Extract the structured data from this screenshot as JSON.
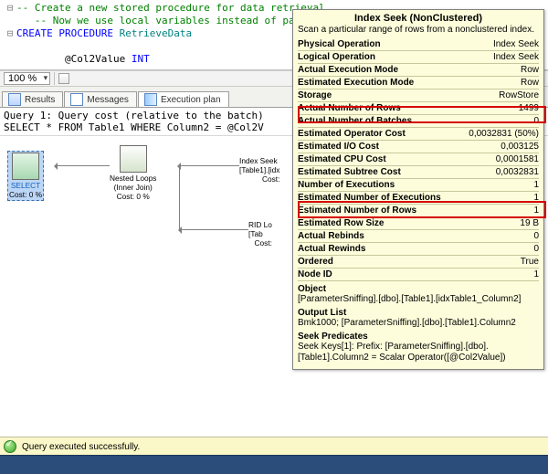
{
  "code": {
    "l1_a": "-- Create a new stored procedure for data retrieval.",
    "l2_a": "   -- Now we use local variables instead of parameter values",
    "l3_kw": "CREATE PROCEDURE ",
    "l3_name": "RetrieveData",
    "l5_a": "        @Col2Value ",
    "l5_kw": "INT"
  },
  "zoom": {
    "value": "100 %"
  },
  "tabs": {
    "results": "Results",
    "messages": "Messages",
    "plan": "Execution plan"
  },
  "qhdr": {
    "l1": "Query 1: Query cost (relative to the batch)",
    "l2": "SELECT * FROM Table1 WHERE Column2 = @Col2V"
  },
  "plan": {
    "select": {
      "l1": "SELECT",
      "l2": "Cost: 0 %"
    },
    "nested": {
      "l1": "Nested Loops",
      "l2": "(Inner Join)",
      "l3": "Cost: 0 %"
    },
    "seek": {
      "l1": "Index Seek",
      "l2": "[Table1].[idx",
      "l3": "Cost:"
    },
    "rid": {
      "l1": "RID Lo",
      "l2": "[Tab",
      "l3": "Cost:"
    }
  },
  "tip": {
    "title": "Index Seek (NonClustered)",
    "desc": "Scan a particular range of rows from a nonclustered index.",
    "rows": [
      {
        "k": "Physical Operation",
        "v": "Index Seek",
        "b": true
      },
      {
        "k": "Logical Operation",
        "v": "Index Seek",
        "b": true
      },
      {
        "k": "Actual Execution Mode",
        "v": "Row",
        "b": true
      },
      {
        "k": "Estimated Execution Mode",
        "v": "Row",
        "b": true
      },
      {
        "k": "Storage",
        "v": "RowStore",
        "b": true
      },
      {
        "k": "Actual Number of Rows",
        "v": "1499",
        "b": true
      },
      {
        "k": "Actual Number of Batches",
        "v": "0",
        "b": true
      },
      {
        "k": "Estimated Operator Cost",
        "v": "0,0032831 (50%)",
        "b": true
      },
      {
        "k": "Estimated I/O Cost",
        "v": "0,003125",
        "b": true
      },
      {
        "k": "Estimated CPU Cost",
        "v": "0,0001581",
        "b": true
      },
      {
        "k": "Estimated Subtree Cost",
        "v": "0,0032831",
        "b": true
      },
      {
        "k": "Number of Executions",
        "v": "1",
        "b": true
      },
      {
        "k": "Estimated Number of Executions",
        "v": "1",
        "b": true
      },
      {
        "k": "Estimated Number of Rows",
        "v": "1",
        "b": true
      },
      {
        "k": "Estimated Row Size",
        "v": "19 B",
        "b": true
      },
      {
        "k": "Actual Rebinds",
        "v": "0",
        "b": true
      },
      {
        "k": "Actual Rewinds",
        "v": "0",
        "b": true
      },
      {
        "k": "Ordered",
        "v": "True",
        "b": true
      },
      {
        "k": "Node ID",
        "v": "1",
        "b": true
      }
    ],
    "object_h": "Object",
    "object": "[ParameterSniffing].[dbo].[Table1].[idxTable1_Column2]",
    "output_h": "Output List",
    "output": "Bmk1000; [ParameterSniffing].[dbo].[Table1].Column2",
    "seek_h": "Seek Predicates",
    "seek1": "Seek Keys[1]: Prefix: [ParameterSniffing].[dbo].",
    "seek2": "[Table1].Column2 = Scalar Operator([@Col2Value])"
  },
  "status": {
    "msg": "Query executed successfully."
  }
}
